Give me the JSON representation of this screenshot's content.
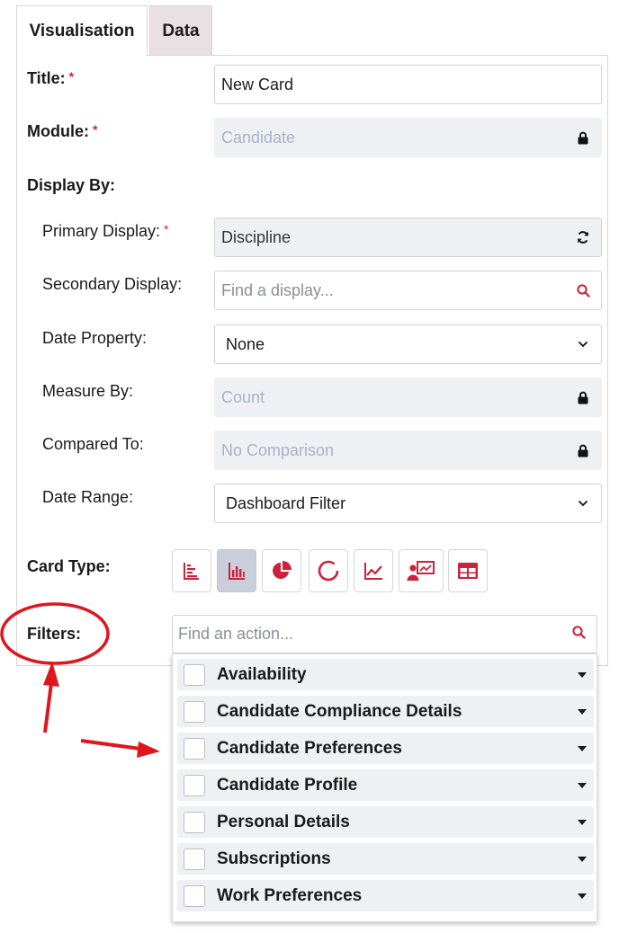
{
  "tabs": [
    {
      "label": "Visualisation",
      "active": true
    },
    {
      "label": "Data",
      "active": false
    }
  ],
  "form": {
    "title_label": "Title:",
    "title_value": "New Card",
    "module_label": "Module:",
    "module_value": "Candidate",
    "display_by_label": "Display By:",
    "primary_label": "Primary Display:",
    "primary_value": "Discipline",
    "secondary_label": "Secondary Display:",
    "secondary_placeholder": "Find a display...",
    "date_property_label": "Date Property:",
    "date_property_value": "None",
    "measure_label": "Measure By:",
    "measure_value": "Count",
    "compared_label": "Compared To:",
    "compared_value": "No Comparison",
    "date_range_label": "Date Range:",
    "date_range_value": "Dashboard Filter",
    "required_mark": "*"
  },
  "card_type": {
    "label": "Card Type:",
    "options": [
      "list-icon",
      "bar-chart-icon",
      "pie-chart-icon",
      "donut-chart-icon",
      "line-chart-icon",
      "presentation-icon",
      "table-icon"
    ],
    "selected": "bar-chart-icon"
  },
  "filters": {
    "label": "Filters:",
    "placeholder": "Find an action...",
    "items": [
      "Availability",
      "Candidate Compliance Details",
      "Candidate Preferences",
      "Candidate Profile",
      "Personal Details",
      "Subscriptions",
      "Work Preferences"
    ]
  },
  "colors": {
    "accent": "#d0203a",
    "annotation": "#e0161e",
    "tab_inactive": "#eadfe2",
    "disabled_field": "#eef0f3",
    "card_type_active": "#c9cfda"
  }
}
